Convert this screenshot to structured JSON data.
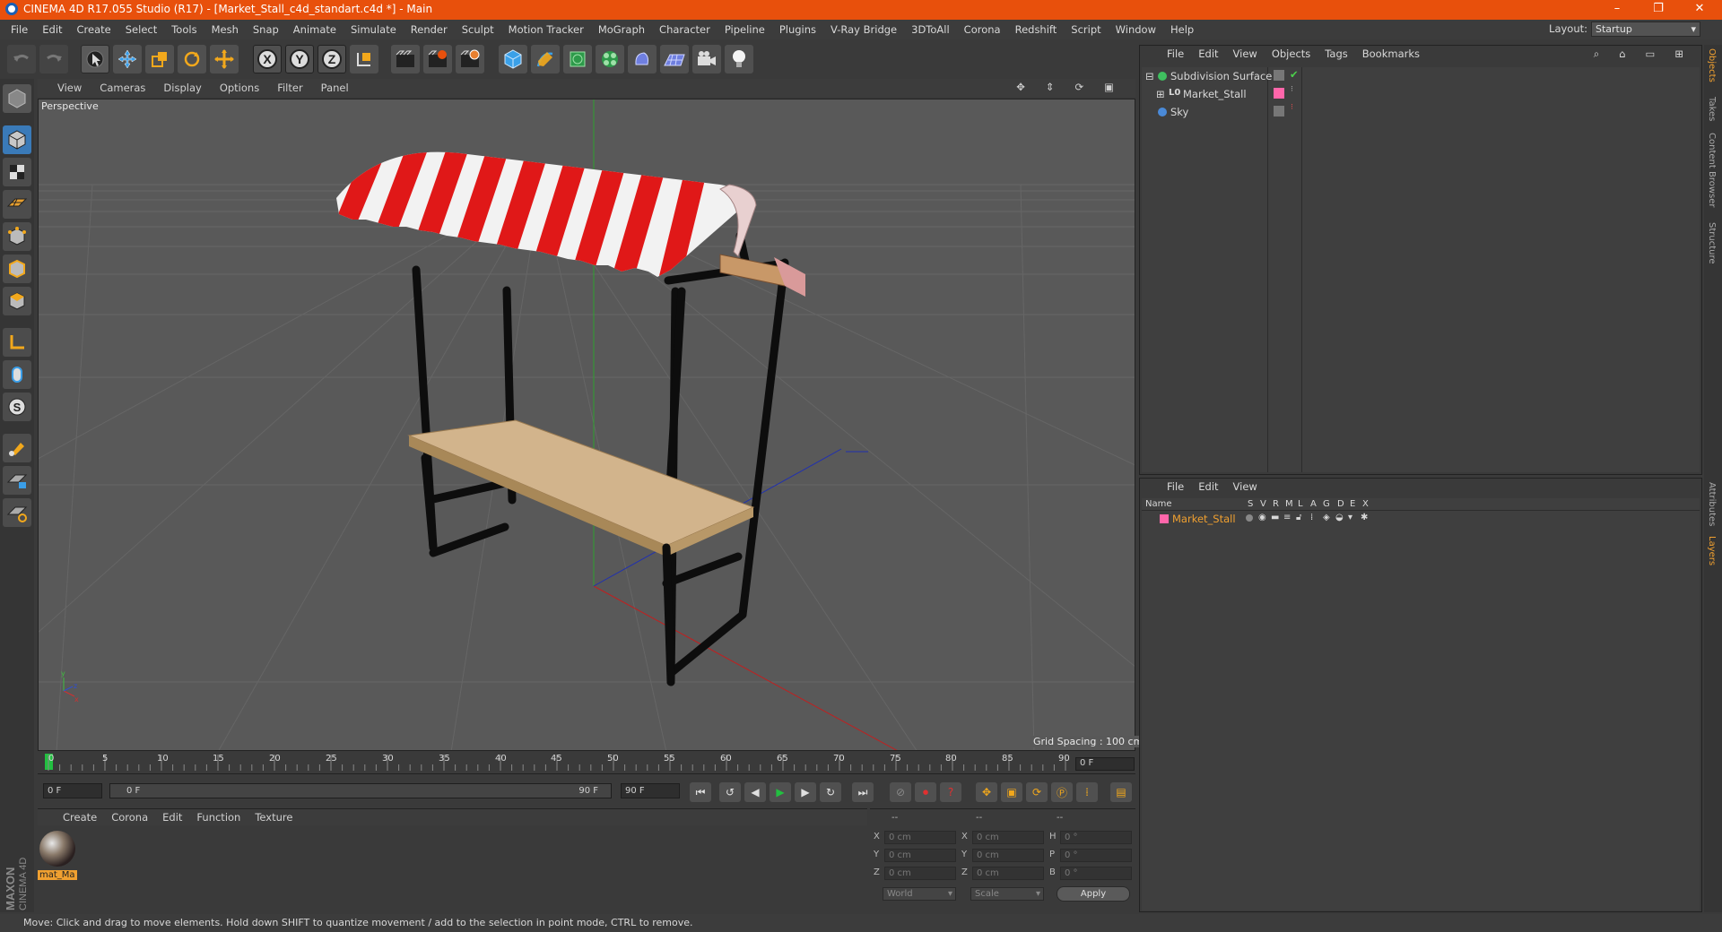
{
  "app": {
    "title": "CINEMA 4D R17.055 Studio (R17) - [Market_Stall_c4d_standart.c4d *] - Main",
    "window_controls": [
      "–",
      "❐",
      "✕"
    ]
  },
  "menu": [
    "File",
    "Edit",
    "Create",
    "Select",
    "Tools",
    "Mesh",
    "Snap",
    "Animate",
    "Simulate",
    "Render",
    "Sculpt",
    "Motion Tracker",
    "MoGraph",
    "Character",
    "Pipeline",
    "Plugins",
    "V-Ray Bridge",
    "3DToAll",
    "Corona",
    "Redshift",
    "Script",
    "Window",
    "Help"
  ],
  "layout": {
    "label": "Layout:",
    "value": "Startup"
  },
  "toolbar": {
    "undo": "undo-icon",
    "redo": "redo-icon",
    "x_label": "X",
    "y_label": "Y",
    "z_label": "Z"
  },
  "viewport": {
    "menu": [
      "View",
      "Cameras",
      "Display",
      "Options",
      "Filter",
      "Panel"
    ],
    "camera": "Perspective",
    "grid_spacing": "Grid Spacing : 100 cm"
  },
  "timeline": {
    "ticks": [
      "0",
      "5",
      "10",
      "15",
      "20",
      "25",
      "30",
      "35",
      "40",
      "45",
      "50",
      "55",
      "60",
      "65",
      "70",
      "75",
      "80",
      "85",
      "90"
    ],
    "current_frame": "0 F"
  },
  "transport": {
    "start": "0 F",
    "range_start": "0 F",
    "range_end": "90 F",
    "end": "90 F"
  },
  "materials": {
    "menu": [
      "Create",
      "Corona",
      "Edit",
      "Function",
      "Texture"
    ],
    "items": [
      {
        "name": "mat_Ma"
      }
    ]
  },
  "coordinates": {
    "headers": [
      "--",
      "--",
      "--"
    ],
    "rows": [
      {
        "a": "X",
        "av": "0 cm",
        "b": "X",
        "bv": "0 cm",
        "c": "H",
        "cv": "0 °"
      },
      {
        "a": "Y",
        "av": "0 cm",
        "b": "Y",
        "bv": "0 cm",
        "c": "P",
        "cv": "0 °"
      },
      {
        "a": "Z",
        "av": "0 cm",
        "b": "Z",
        "bv": "0 cm",
        "c": "B",
        "cv": "0 °"
      }
    ],
    "mode1": "World",
    "mode2": "Scale",
    "apply": "Apply"
  },
  "object_manager": {
    "menu": [
      "File",
      "Edit",
      "View",
      "Objects",
      "Tags",
      "Bookmarks"
    ],
    "objects": [
      {
        "name": "Subdivision Surface",
        "indent": 0
      },
      {
        "name": "Market_Stall",
        "indent": 1
      },
      {
        "name": "Sky",
        "indent": 0
      }
    ]
  },
  "layer_manager": {
    "menu": [
      "File",
      "Edit",
      "View"
    ],
    "columns": [
      "Name",
      "S",
      "V",
      "R",
      "M",
      "L",
      "A",
      "G",
      "D",
      "E",
      "X"
    ],
    "layers": [
      {
        "name": "Market_Stall",
        "color": "#ff66aa"
      }
    ]
  },
  "side_tabs": [
    "Objects",
    "Takes",
    "Content Browser",
    "Structure",
    "Attributes",
    "Layers"
  ],
  "status": "Move: Click and drag to move elements. Hold down SHIFT to quantize movement / add to the selection in point mode, CTRL to remove.",
  "brand": {
    "line1": "MAXON",
    "line2": "CINEMA 4D"
  },
  "colors": {
    "title_bar": "#e8500c",
    "accent": "#f0a030",
    "viewport_bg": "#585858"
  }
}
